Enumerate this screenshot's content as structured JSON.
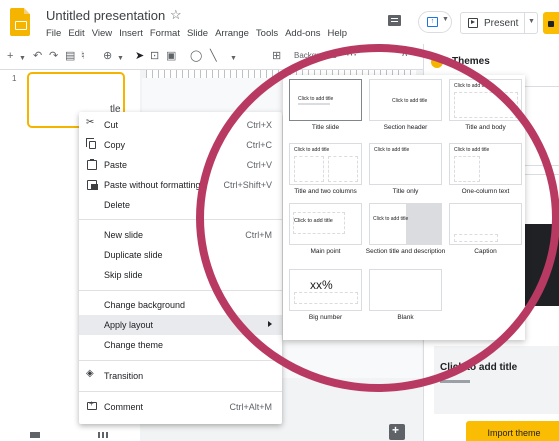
{
  "header": {
    "doc_title": "Untitled presentation",
    "menus": [
      "File",
      "Edit",
      "View",
      "Insert",
      "Format",
      "Slide",
      "Arrange",
      "Tools",
      "Add-ons",
      "Help"
    ],
    "present_label": "Present"
  },
  "toolbar": {
    "background_label": "Background",
    "more_label": "⋯"
  },
  "filmstrip": {
    "slide_number": "1"
  },
  "context_menu": {
    "items": [
      {
        "label": "Cut",
        "shortcut": "Ctrl+X",
        "icon": "cut-icon"
      },
      {
        "label": "Copy",
        "shortcut": "Ctrl+C",
        "icon": "copy-icon"
      },
      {
        "label": "Paste",
        "shortcut": "Ctrl+V",
        "icon": "paste-icon"
      },
      {
        "label": "Paste without formatting",
        "shortcut": "Ctrl+Shift+V",
        "icon": "paste-format-icon"
      },
      {
        "label": "Delete",
        "shortcut": ""
      },
      {
        "label": "New slide",
        "shortcut": "Ctrl+M"
      },
      {
        "label": "Duplicate slide",
        "shortcut": ""
      },
      {
        "label": "Skip slide",
        "shortcut": ""
      },
      {
        "label": "Change background",
        "shortcut": ""
      },
      {
        "label": "Apply layout",
        "shortcut": ""
      },
      {
        "label": "Change theme",
        "shortcut": ""
      },
      {
        "label": "Transition",
        "shortcut": "",
        "icon": "transition-icon"
      },
      {
        "label": "Comment",
        "shortcut": "Ctrl+Alt+M",
        "icon": "comment-icon"
      }
    ]
  },
  "layouts": {
    "items": [
      {
        "name": "Title slide",
        "thumb_text": "Click to add title"
      },
      {
        "name": "Section header",
        "thumb_text": "Click to add title"
      },
      {
        "name": "Title and body",
        "thumb_text": "Click to add title"
      },
      {
        "name": "Title and two columns",
        "thumb_text": "Click to add title"
      },
      {
        "name": "Title only",
        "thumb_text": "Click to add title"
      },
      {
        "name": "One-column text",
        "thumb_text": "Click to add title"
      },
      {
        "name": "Main point",
        "thumb_text": "Click to add title"
      },
      {
        "name": "Section title and description",
        "thumb_text": "Click to add title"
      },
      {
        "name": "Caption",
        "thumb_text": ""
      },
      {
        "name": "Big number",
        "thumb_text": "xx%"
      },
      {
        "name": "Blank",
        "thumb_text": ""
      }
    ]
  },
  "themes_panel": {
    "title": "Themes",
    "card_tle_1": "tle",
    "card_tle_2": "tle",
    "card_4_title": "Click to add title",
    "import_label": "Import theme"
  },
  "colors": {
    "accent_yellow": "#f4b400",
    "highlight_ring": "#b83a63"
  }
}
